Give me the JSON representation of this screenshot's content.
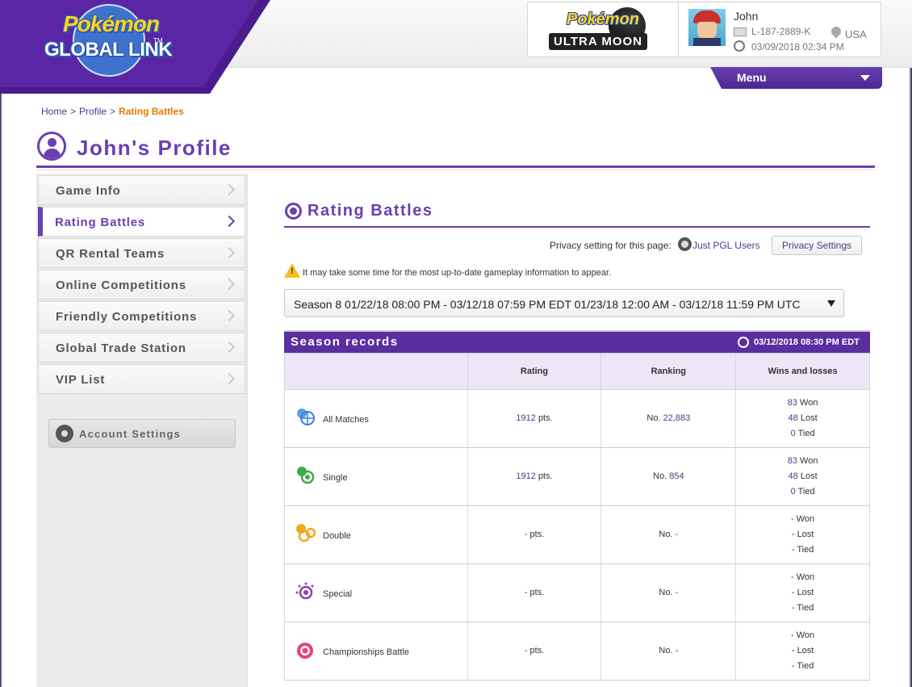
{
  "header": {
    "logo_line1": "Pokémon",
    "logo_line2": "GLOBAL LINK",
    "logo_tm": "TM",
    "game_logo_line1": "Pokémon",
    "game_logo_line2": "ULTRA MOON",
    "user": {
      "name": "John",
      "id": "L-187-2889-K",
      "datetime": "03/09/2018 02:34 PM",
      "country": "USA"
    },
    "menu_label": "Menu"
  },
  "breadcrumb": {
    "home": "Home",
    "profile": "Profile",
    "current": "Rating Battles",
    "sep": ">"
  },
  "page_title": "John's Profile",
  "sidebar": {
    "items": [
      {
        "label": "Game Info"
      },
      {
        "label": "Rating Battles"
      },
      {
        "label": "QR Rental Teams"
      },
      {
        "label": "Online Competitions"
      },
      {
        "label": "Friendly Competitions"
      },
      {
        "label": "Global Trade Station"
      },
      {
        "label": "VIP List"
      }
    ],
    "account_settings": "Account Settings"
  },
  "main": {
    "section_title": "Rating Battles",
    "privacy_label": "Privacy setting for this page:",
    "privacy_value": "Just PGL Users",
    "privacy_button": "Privacy Settings",
    "warning": "It may take some time for the most up-to-date gameplay information to appear.",
    "season_select": "Season 8    01/22/18 08:00 PM - 03/12/18 07:59 PM EDT    01/23/18 12:00 AM - 03/12/18 11:59 PM UTC",
    "records_title": "Season records",
    "records_date": "03/12/2018 08:30 PM  EDT",
    "table": {
      "headers": [
        "",
        "Rating",
        "Ranking",
        "Wins and losses"
      ],
      "rows": [
        {
          "name": "All Matches",
          "rating": "1912",
          "pts": "pts.",
          "rank_prefix": "No.",
          "rank": "22,883",
          "won": "83",
          "lost": "48",
          "tied": "0"
        },
        {
          "name": "Single",
          "rating": "1912",
          "pts": "pts.",
          "rank_prefix": "No.",
          "rank": "854",
          "won": "83",
          "lost": "48",
          "tied": "0"
        },
        {
          "name": "Double",
          "rating": "-",
          "pts": "pts.",
          "rank_prefix": "No.",
          "rank": "-",
          "won": "-",
          "lost": "-",
          "tied": "-"
        },
        {
          "name": "Special",
          "rating": "-",
          "pts": "pts.",
          "rank_prefix": "No.",
          "rank": "-",
          "won": "-",
          "lost": "-",
          "tied": "-"
        },
        {
          "name": "Championships Battle",
          "rating": "-",
          "pts": "pts.",
          "rank_prefix": "No.",
          "rank": "-",
          "won": "-",
          "lost": "-",
          "tied": "-"
        }
      ],
      "won_label": "Won",
      "lost_label": "Lost",
      "tied_label": "Tied"
    }
  },
  "colors": {
    "accent": "#6a3fb0",
    "link": "#4a3a8a",
    "breadcrumb_current": "#e07b00"
  }
}
